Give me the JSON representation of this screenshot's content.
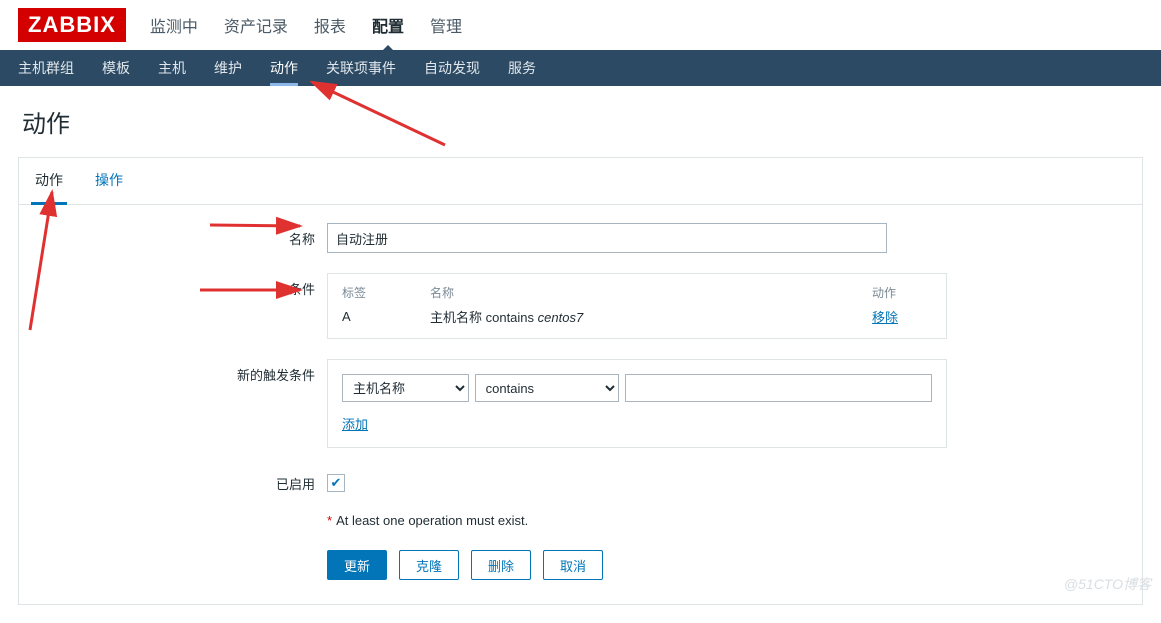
{
  "brand": "ZABBIX",
  "top_nav": {
    "items": [
      "监测中",
      "资产记录",
      "报表",
      "配置",
      "管理"
    ],
    "active_index": 3
  },
  "sub_nav": {
    "items": [
      "主机群组",
      "模板",
      "主机",
      "维护",
      "动作",
      "关联项事件",
      "自动发现",
      "服务"
    ],
    "active_index": 4
  },
  "page_title": "动作",
  "tabs": {
    "items": [
      "动作",
      "操作"
    ],
    "active_index": 0
  },
  "form": {
    "name_label": "名称",
    "new_trigger_label": "新的触发条件",
    "name_value": "自动注册",
    "cond_label": "条件",
    "cond_header": {
      "tag": "标签",
      "name": "名称",
      "action": "动作"
    },
    "cond_rows": [
      {
        "tag": "A",
        "name_prefix": "主机名称 contains ",
        "name_italic": "centos7",
        "action": "移除"
      }
    ],
    "trigger_select1": "主机名称",
    "trigger_select2": "contains",
    "trigger_value": "",
    "add_link": "添加",
    "enabled_label": "已启用",
    "enabled_checked": true,
    "warning": "At least one operation must exist.",
    "buttons": {
      "update": "更新",
      "clone": "克隆",
      "delete": "删除",
      "cancel": "取消"
    }
  },
  "watermark": "@51CTO博客"
}
